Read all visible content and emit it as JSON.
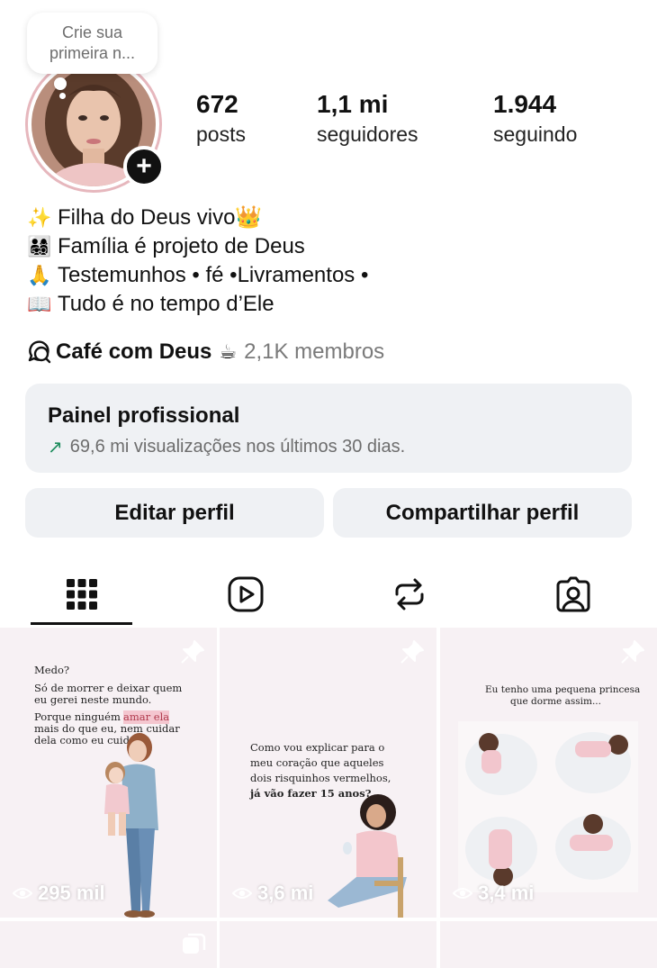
{
  "note": {
    "text": "Crie sua primeira n..."
  },
  "profile": {
    "stats": [
      {
        "value": "672",
        "label": "posts"
      },
      {
        "value": "1,1 mi",
        "label": "seguidores"
      },
      {
        "value": "1.944",
        "label": "seguindo"
      }
    ],
    "bio": [
      {
        "emoji": "✨",
        "text": "Filha do Deus vivo👑"
      },
      {
        "emoji": "👨‍👩‍👧‍👦",
        "text": "Família é projeto de Deus"
      },
      {
        "emoji": "🙏",
        "text": " Testemunhos • fé •Livramentos •"
      },
      {
        "emoji": "📖",
        "text": " Tudo é no tempo d’Ele"
      }
    ],
    "channel": {
      "name": "Café com Deus",
      "emoji": "☕",
      "members": "2,1K membros"
    }
  },
  "panel": {
    "title": "Painel profissional",
    "subtitle": "69,6 mi visualizações nos últimos 30 dias."
  },
  "buttons": {
    "edit": "Editar perfil",
    "share": "Compartilhar perfil"
  },
  "tabs": [
    {
      "icon": "grid-icon",
      "active": true
    },
    {
      "icon": "reels-icon",
      "active": false
    },
    {
      "icon": "reposts-icon",
      "active": false
    },
    {
      "icon": "tagged-icon",
      "active": false
    }
  ],
  "posts": [
    {
      "views": "295 mil",
      "lines": [
        "Medo?",
        "Só de morrer e deixar quem",
        "eu gerei neste mundo.",
        "Porque ninguém vai",
        "amar ela",
        "mais do que eu, nem cuidar",
        "dela como eu cuido."
      ]
    },
    {
      "views": "3,6 mi",
      "lines": [
        "Como vou explicar para o",
        "meu coração que aqueles",
        "dois risquinhos vermelhos,",
        "já vão fazer 15 anos?"
      ]
    },
    {
      "views": "3,4 mi",
      "lines": [
        "Eu tenho uma pequena princesa",
        "que dorme assim..."
      ]
    }
  ]
}
